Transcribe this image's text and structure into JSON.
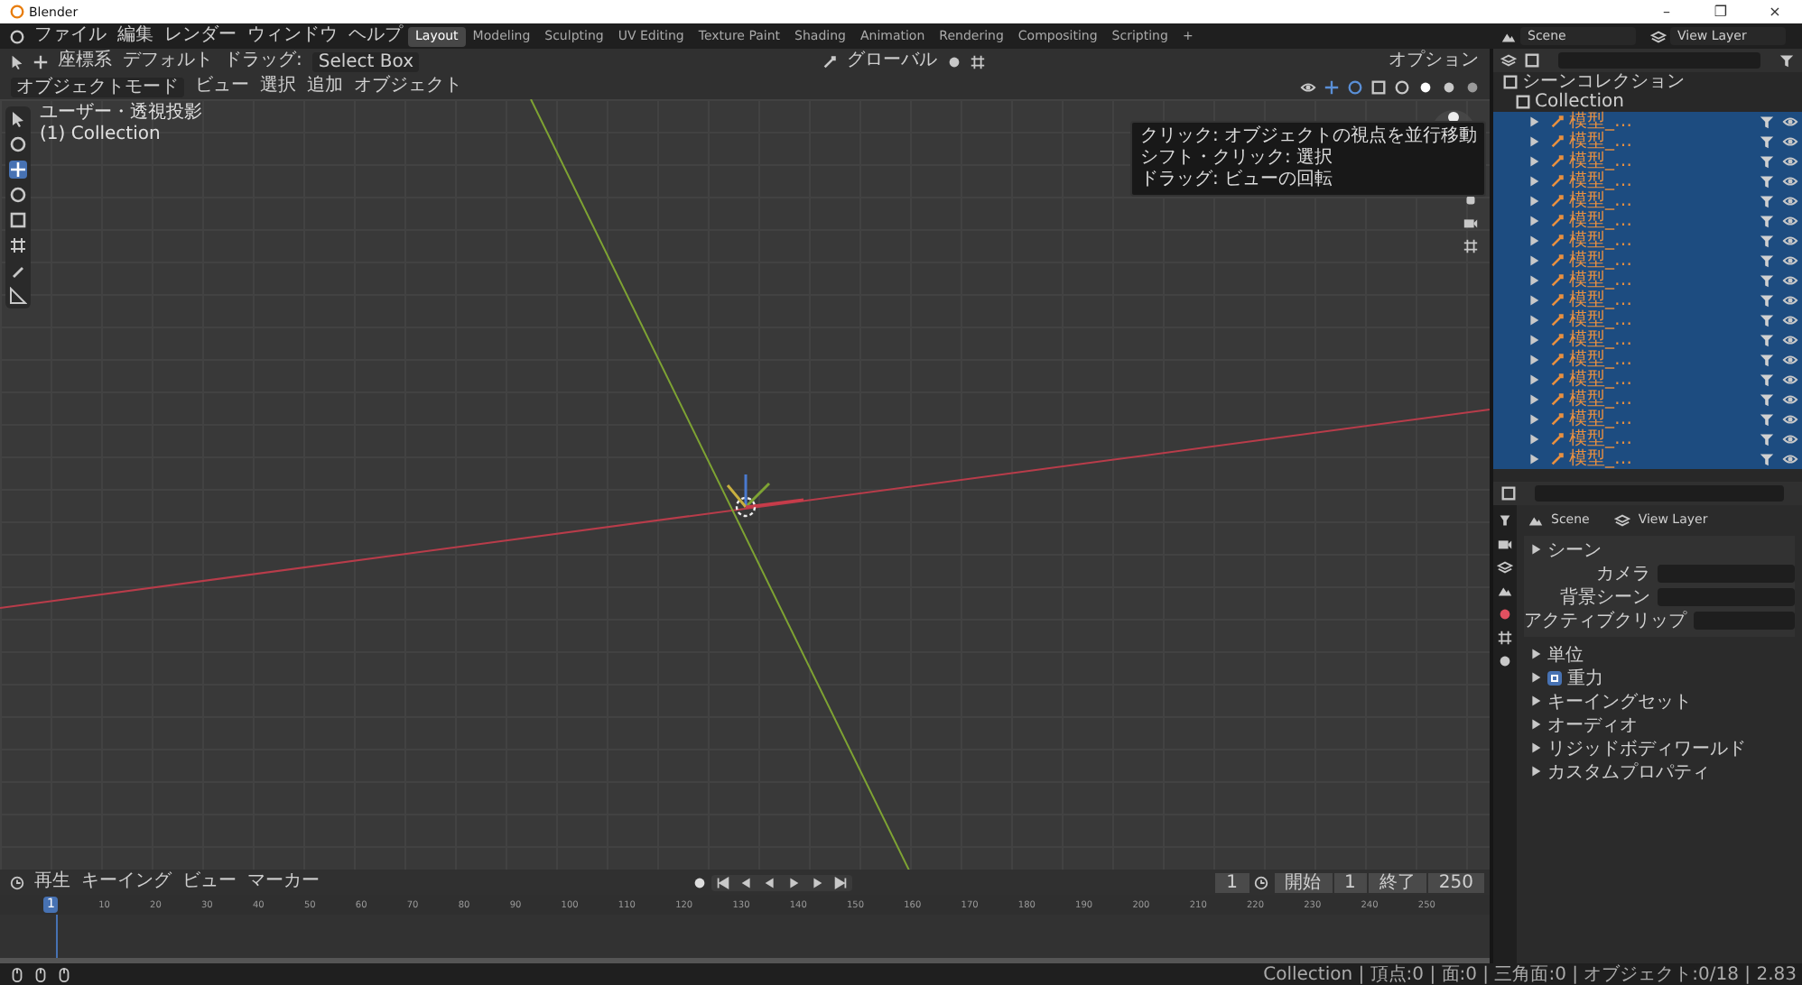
{
  "window": {
    "title": "Blender",
    "controls": [
      "–",
      "❐",
      "×"
    ]
  },
  "menu": [
    "ファイル",
    "編集",
    "レンダー",
    "ウィンドウ",
    "ヘルプ"
  ],
  "workspaces": [
    {
      "label": "Layout",
      "selected": true
    },
    {
      "label": "Modeling",
      "selected": false
    },
    {
      "label": "Sculpting",
      "selected": false
    },
    {
      "label": "UV Editing",
      "selected": false
    },
    {
      "label": "Texture Paint",
      "selected": false
    },
    {
      "label": "Shading",
      "selected": false
    },
    {
      "label": "Animation",
      "selected": false
    },
    {
      "label": "Rendering",
      "selected": false
    },
    {
      "label": "Compositing",
      "selected": false
    },
    {
      "label": "Scripting",
      "selected": false
    }
  ],
  "add_workspace": "+",
  "scene": "Scene",
  "view_layer": "View Layer",
  "viewport_header": {
    "row1": [
      "座標系",
      "デフォルト",
      "ドラッグ:",
      "Select Box"
    ],
    "row2": [
      "オブジェクトモード",
      "ビュー",
      "選択",
      "追加",
      "オブジェクト"
    ],
    "orientation": "グローバル",
    "options": "オプション"
  },
  "viewport": {
    "view_name": "ユーザー・透視投影",
    "collection": "(1) Collection"
  },
  "tooltip": [
    "クリック: オブジェクトの視点を並行移動",
    "シフト・クリック: 選択",
    "ドラッグ: ビューの回転"
  ],
  "outliner": {
    "scene_collection": "シーンコレクション",
    "collection": "Collection",
    "objects": [
      {
        "name": "模型_…",
        "selected": true
      },
      {
        "name": "模型_…",
        "selected": true
      },
      {
        "name": "模型_…",
        "selected": true
      },
      {
        "name": "模型_…",
        "selected": true
      },
      {
        "name": "模型_…",
        "selected": true
      },
      {
        "name": "模型_…",
        "selected": true
      },
      {
        "name": "模型_…",
        "selected": true
      },
      {
        "name": "模型_…",
        "selected": true
      },
      {
        "name": "模型_…",
        "selected": true
      },
      {
        "name": "模型_…",
        "selected": true
      },
      {
        "name": "模型_…",
        "selected": true
      },
      {
        "name": "模型_…",
        "selected": true
      },
      {
        "name": "模型_…",
        "selected": true
      },
      {
        "name": "模型_…",
        "selected": true
      },
      {
        "name": "模型_…",
        "selected": true
      },
      {
        "name": "模型_…",
        "selected": true
      },
      {
        "name": "模型_…",
        "selected": true
      },
      {
        "name": "模型_…",
        "selected": true
      }
    ]
  },
  "properties": {
    "breadcrumbs": [
      "Scene",
      "View Layer"
    ],
    "panel": "シーン",
    "fields": [
      {
        "label": "カメラ"
      },
      {
        "label": "背景シーン"
      },
      {
        "label": "アクティブクリップ"
      }
    ],
    "sections": [
      {
        "label": "単位",
        "kind": "section"
      },
      {
        "label": "重力",
        "kind": "checkbox",
        "checked": true
      },
      {
        "label": "キーイングセット",
        "kind": "section"
      },
      {
        "label": "オーディオ",
        "kind": "section"
      },
      {
        "label": "リジッドボディワールド",
        "kind": "section"
      },
      {
        "label": "カスタムプロパティ",
        "kind": "section"
      }
    ]
  },
  "timeline": {
    "menus": [
      "再生",
      "キーイング",
      "ビュー",
      "マーカー"
    ],
    "current_frame": "1",
    "start_label": "開始",
    "start": "1",
    "end_label": "終了",
    "end": "250",
    "playhead": "1",
    "ticks": [
      "10",
      "20",
      "30",
      "40",
      "50",
      "60",
      "70",
      "80",
      "90",
      "100",
      "110",
      "120",
      "130",
      "140",
      "150",
      "160",
      "170",
      "180",
      "190",
      "200",
      "210",
      "220",
      "230",
      "240",
      "250"
    ]
  },
  "status_bar": "Collection | 頂点:0 | 面:0 | 三角面:0 | オブジェクト:0/18 | 2.83"
}
